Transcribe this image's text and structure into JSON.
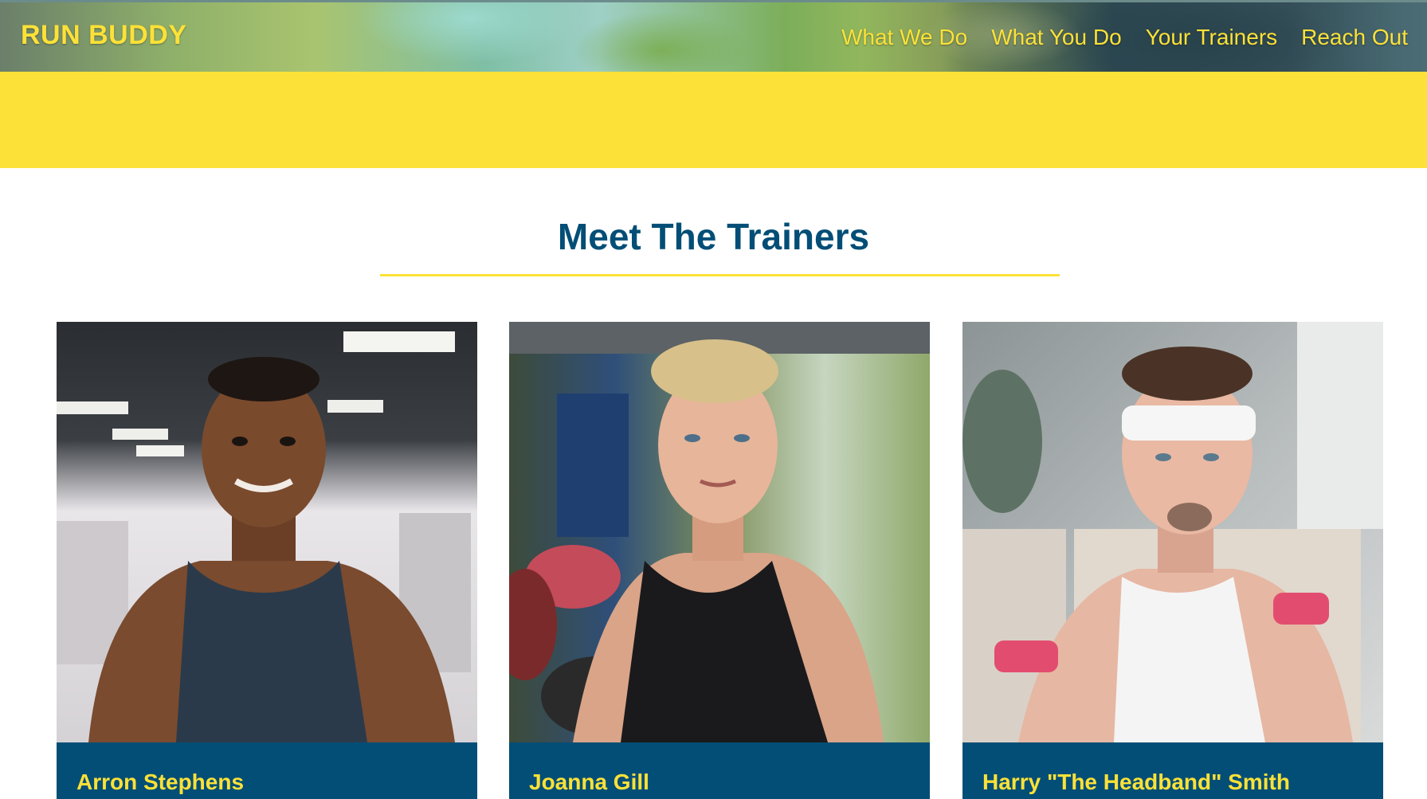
{
  "header": {
    "brand": "RUN BUDDY",
    "nav": [
      {
        "label": "What We Do"
      },
      {
        "label": "What You Do"
      },
      {
        "label": "Your Trainers"
      },
      {
        "label": "Reach Out"
      }
    ]
  },
  "section": {
    "title": "Meet The Trainers"
  },
  "trainers": [
    {
      "name": "Arron Stephens"
    },
    {
      "name": "Joanna Gill"
    },
    {
      "name": "Harry \"The Headband\" Smith"
    }
  ],
  "colors": {
    "brand_yellow": "#fce138",
    "brand_blue": "#024e76"
  }
}
